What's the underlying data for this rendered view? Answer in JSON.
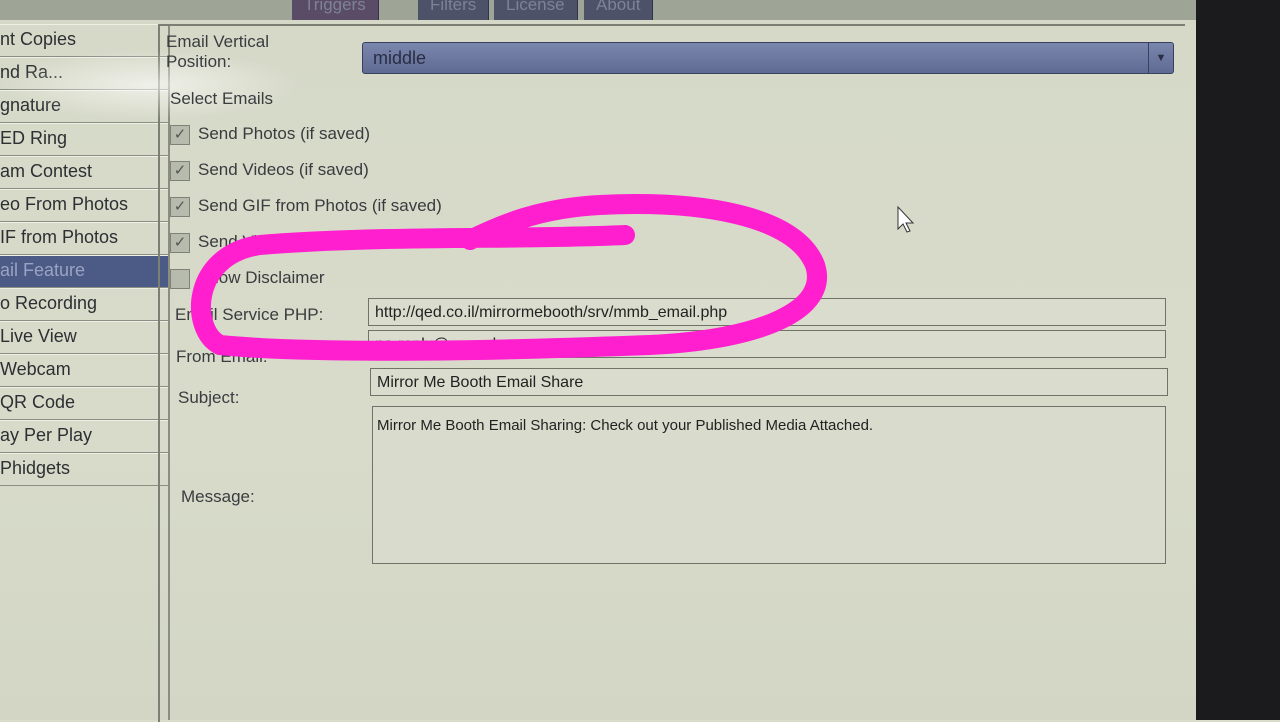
{
  "tabs": [
    "Triggers",
    "Filters",
    "License",
    "About"
  ],
  "sidebar": {
    "items": [
      "nt Copies",
      "nd Ra...",
      "gnature",
      "ED Ring",
      "am Contest",
      "eo From Photos",
      "IF from Photos",
      "ail Feature",
      "o Recording",
      "Live View",
      "Webcam",
      "QR Code",
      "ay Per Play",
      "Phidgets"
    ],
    "selected_index": 7
  },
  "email": {
    "vertical_label": "Email Vertical",
    "vertical_label2": "Position:",
    "vertical_value": "middle",
    "section_label": "Select Emails",
    "checks": [
      {
        "label": "Send Photos (if saved)",
        "checked": true
      },
      {
        "label": "Send Videos (if saved)",
        "checked": true
      },
      {
        "label": "Send GIF from Photos (if saved)",
        "checked": true
      },
      {
        "label": "Send Vi...",
        "checked": true
      },
      {
        "label": "Show Disclaimer",
        "checked": false
      }
    ],
    "php_label": "Email Service PHP:",
    "php_value": "http://qed.co.il/mirrormebooth/srv/mmb_email.php",
    "from_label": "From Email:",
    "from_value": "no-reply@cpanel.q...",
    "subject_label": "Subject:",
    "subject_value": "Mirror Me Booth Email Share",
    "message_label": "Message:",
    "message_value": "Mirror Me Booth Email Sharing: Check out your Published Media Attached."
  },
  "annotation_color": "#ff1fce"
}
